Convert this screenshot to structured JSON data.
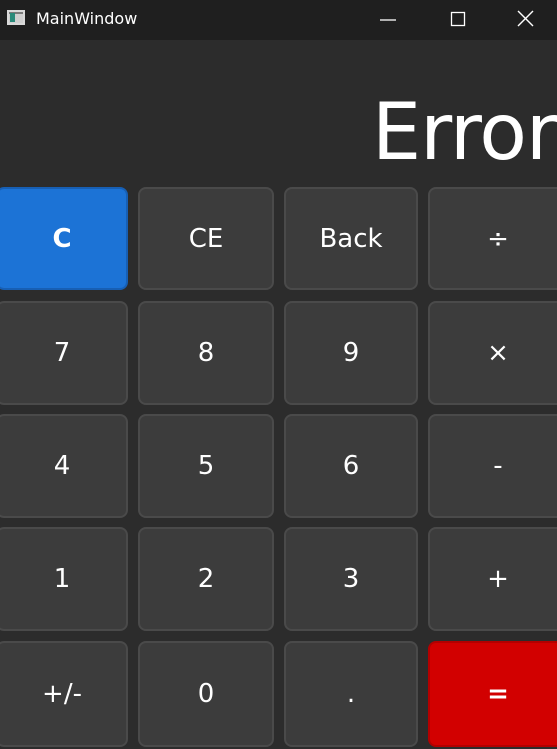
{
  "window": {
    "title": "MainWindow",
    "controls": [
      "minimize-icon",
      "maximize-icon",
      "close-icon"
    ]
  },
  "display": {
    "value": "Error"
  },
  "keypad": {
    "rows": [
      [
        "C",
        "CE",
        "Back",
        "÷"
      ],
      [
        "7",
        "8",
        "9",
        "×"
      ],
      [
        "4",
        "5",
        "6",
        "-"
      ],
      [
        "1",
        "2",
        "3",
        "+"
      ],
      [
        "+/-",
        "0",
        ".",
        "="
      ]
    ]
  },
  "colors": {
    "background": "#2c2c2c",
    "titlebar": "#1f1f1f",
    "key": "#3c3c3c",
    "clear_key": "#1c73d6",
    "equals_key": "#d20000",
    "text": "#ffffff"
  }
}
